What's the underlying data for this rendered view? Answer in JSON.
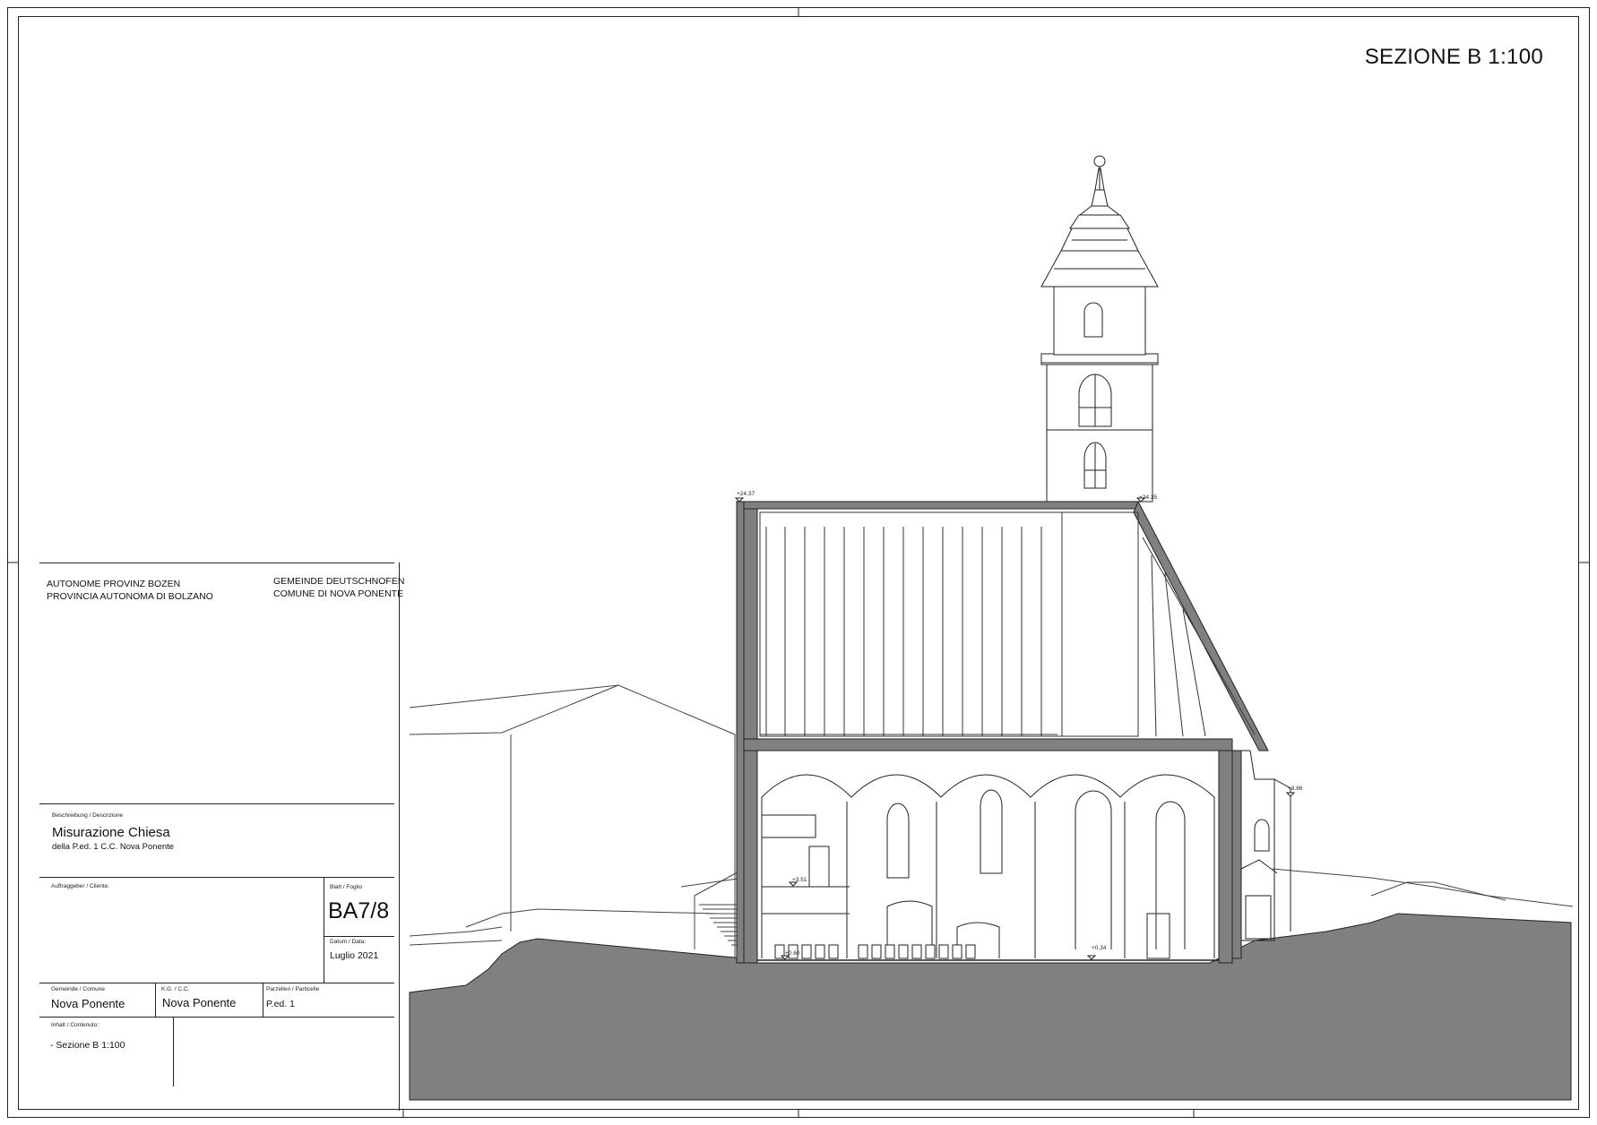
{
  "sheet": {
    "title": "SEZIONE B 1:100"
  },
  "title_block": {
    "authority_de": "AUTONOME PROVINZ BOZEN",
    "authority_it": "PROVINCIA AUTONOMA DI BOLZANO",
    "municipality_de": "GEMEINDE DEUTSCHNOFEN",
    "municipality_it": "COMUNE DI NOVA PONENTE",
    "description_label": "Beschreibung / Descrizione",
    "description_title": "Misurazione Chiesa",
    "description_sub": "della P.ed. 1 C.C. Nova Ponente",
    "client_label": "Auftraggeber / Cliente:",
    "sheet_label": "Blatt / Foglio",
    "sheet_number": "BA7/8",
    "date_label": "Datum / Data:",
    "date_value": "Luglio 2021",
    "municipality_label": "Gemeinde / Comune",
    "municipality_value": "Nova Ponente",
    "kg_label": "K.G. / C.C.",
    "kg_value": "Nova Ponente",
    "parcel_label": "Parzellen / Particelle",
    "parcel_value": "P.ed. 1",
    "content_label": "Inhalt / Contenuto:",
    "content_value": "- Sezione B 1:100"
  },
  "elevations": {
    "roof_left": "+24.37",
    "roof_right": "+24.35",
    "annex": "+8.86",
    "mezzanine": "+3.51",
    "floor_left": "+0.60",
    "floor_right": "+0.34"
  }
}
